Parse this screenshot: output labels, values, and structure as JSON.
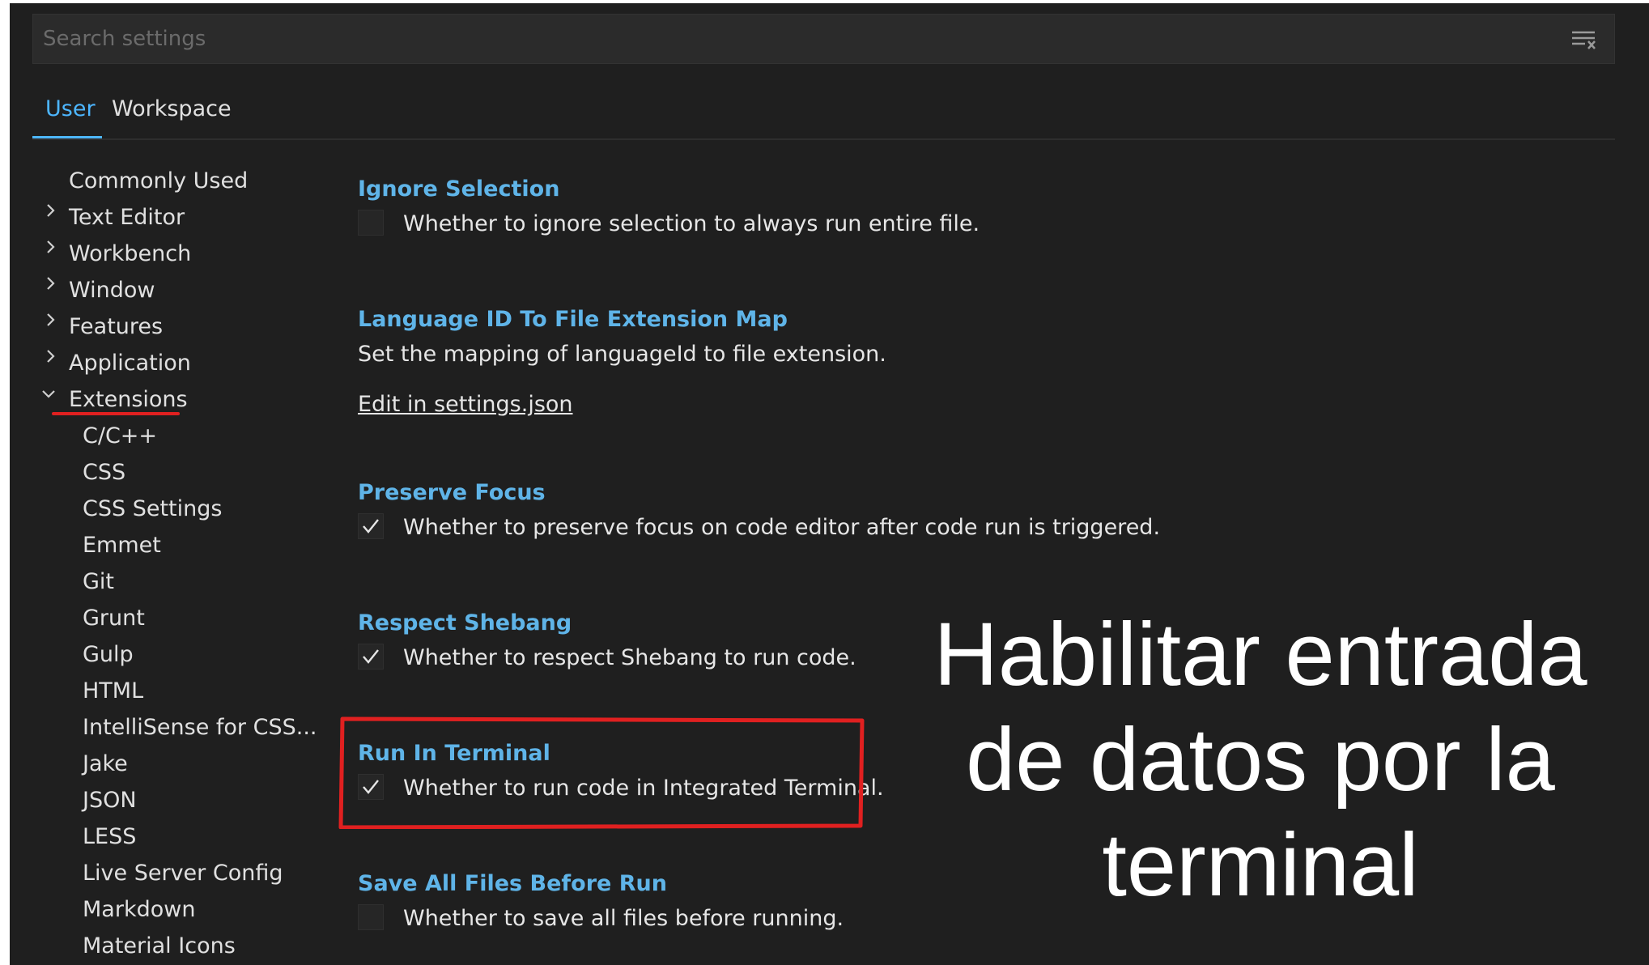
{
  "search": {
    "placeholder": "Search settings",
    "filter_icon": "clear-filter-icon"
  },
  "tabs": [
    {
      "label": "User",
      "active": true
    },
    {
      "label": "Workspace",
      "active": false
    }
  ],
  "toc": {
    "items": [
      {
        "label": "Commonly Used"
      },
      {
        "label": "Text Editor",
        "chevron": "right"
      },
      {
        "label": "Workbench",
        "chevron": "right"
      },
      {
        "label": "Window",
        "chevron": "right"
      },
      {
        "label": "Features",
        "chevron": "right"
      },
      {
        "label": "Application",
        "chevron": "right"
      },
      {
        "label": "Extensions",
        "chevron": "down"
      },
      {
        "label": "C/C++"
      },
      {
        "label": "CSS"
      },
      {
        "label": "CSS Settings"
      },
      {
        "label": "Emmet"
      },
      {
        "label": "Git"
      },
      {
        "label": "Grunt"
      },
      {
        "label": "Gulp"
      },
      {
        "label": "HTML"
      },
      {
        "label": "IntelliSense for CSS..."
      },
      {
        "label": "Jake"
      },
      {
        "label": "JSON"
      },
      {
        "label": "LESS"
      },
      {
        "label": "Live Server Config"
      },
      {
        "label": "Markdown"
      },
      {
        "label": "Material Icons"
      }
    ]
  },
  "settings": {
    "ignore_selection": {
      "title": "Ignore Selection",
      "desc": "Whether to ignore selection to always run entire file.",
      "checked": false
    },
    "language_map": {
      "title": "Language ID To File Extension Map",
      "desc": "Set the mapping of languageId to file extension.",
      "link": "Edit in settings.json"
    },
    "preserve_focus": {
      "title": "Preserve Focus",
      "desc": "Whether to preserve focus on code editor after code run is triggered.",
      "checked": true
    },
    "respect_shebang": {
      "title": "Respect Shebang",
      "desc": "Whether to respect Shebang to run code.",
      "checked": true
    },
    "run_in_terminal": {
      "title": "Run In Terminal",
      "desc": "Whether to run code in Integrated Terminal.",
      "checked": true
    },
    "save_all_files": {
      "title": "Save All Files Before Run",
      "desc": "Whether to save all files before running.",
      "checked": false
    }
  },
  "overlay": {
    "line1": "Habilitar entrada",
    "line2": "de datos por la",
    "line3": "terminal"
  },
  "colors": {
    "accent": "#4db6ff",
    "title": "#5fb4e8",
    "annotation": "#e02020",
    "background": "#1f1f1f"
  }
}
